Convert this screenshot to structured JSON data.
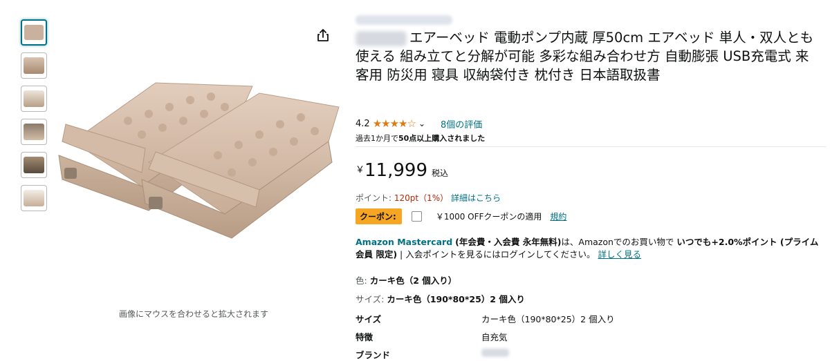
{
  "gallery": {
    "thumbnails": [
      "thumb-1",
      "thumb-2",
      "thumb-3",
      "thumb-4",
      "thumb-5",
      "thumb-6"
    ],
    "hover_hint": "画像にマウスを合わせると拡大されます"
  },
  "product": {
    "title": "エアーベッド 電動ポンプ内蔵 厚50cm エアベッド 単人・双人とも使える 組み立てと分解が可能 多彩な組み合わせ方 自動膨張 USB充電式 来客用 防災用 寝具 収納袋付き 枕付き 日本語取扱書",
    "rating_value": "4.2",
    "stars": "★★★★☆",
    "ratings_link": "8個の評価",
    "bought_prefix": "過去1か月で",
    "bought_count": "50点以上購入されました",
    "price_currency": "￥",
    "price_amount": "11,999",
    "price_tax": "税込",
    "points_label": "ポイント: ",
    "points_value": "120pt（1%）",
    "points_link": "詳細はこちら",
    "coupon_badge": "クーポン:",
    "coupon_text": "￥1000 OFFクーポンの適用",
    "coupon_link": "規約"
  },
  "mastercard": {
    "name": "Amazon Mastercard",
    "fee": "(年会費・入会費 永年無料)",
    "text1": "は、Amazonでのお買い物で ",
    "bold1": "いつでも+2.0%ポイント (プライム会員 限定)",
    "text2": " | 入会ポイントを見るにはログインしてください。",
    "link": "詳しく見る"
  },
  "variants": {
    "color_label": "色: ",
    "color_value": "カーキ色（2 個入り）",
    "size_label": "サイズ: ",
    "size_value": "カーキ色（190*80*25）2 個入り"
  },
  "specs": [
    {
      "key": "サイズ",
      "value": "カーキ色（190*80*25）2 個入り"
    },
    {
      "key": "特徴",
      "value": "自充気"
    },
    {
      "key": "ブランド",
      "value": ""
    }
  ],
  "colors": {
    "accent_link": "#007185",
    "star": "#E07A0F",
    "coupon_bg": "#F7A623",
    "points_red": "#B12704"
  }
}
